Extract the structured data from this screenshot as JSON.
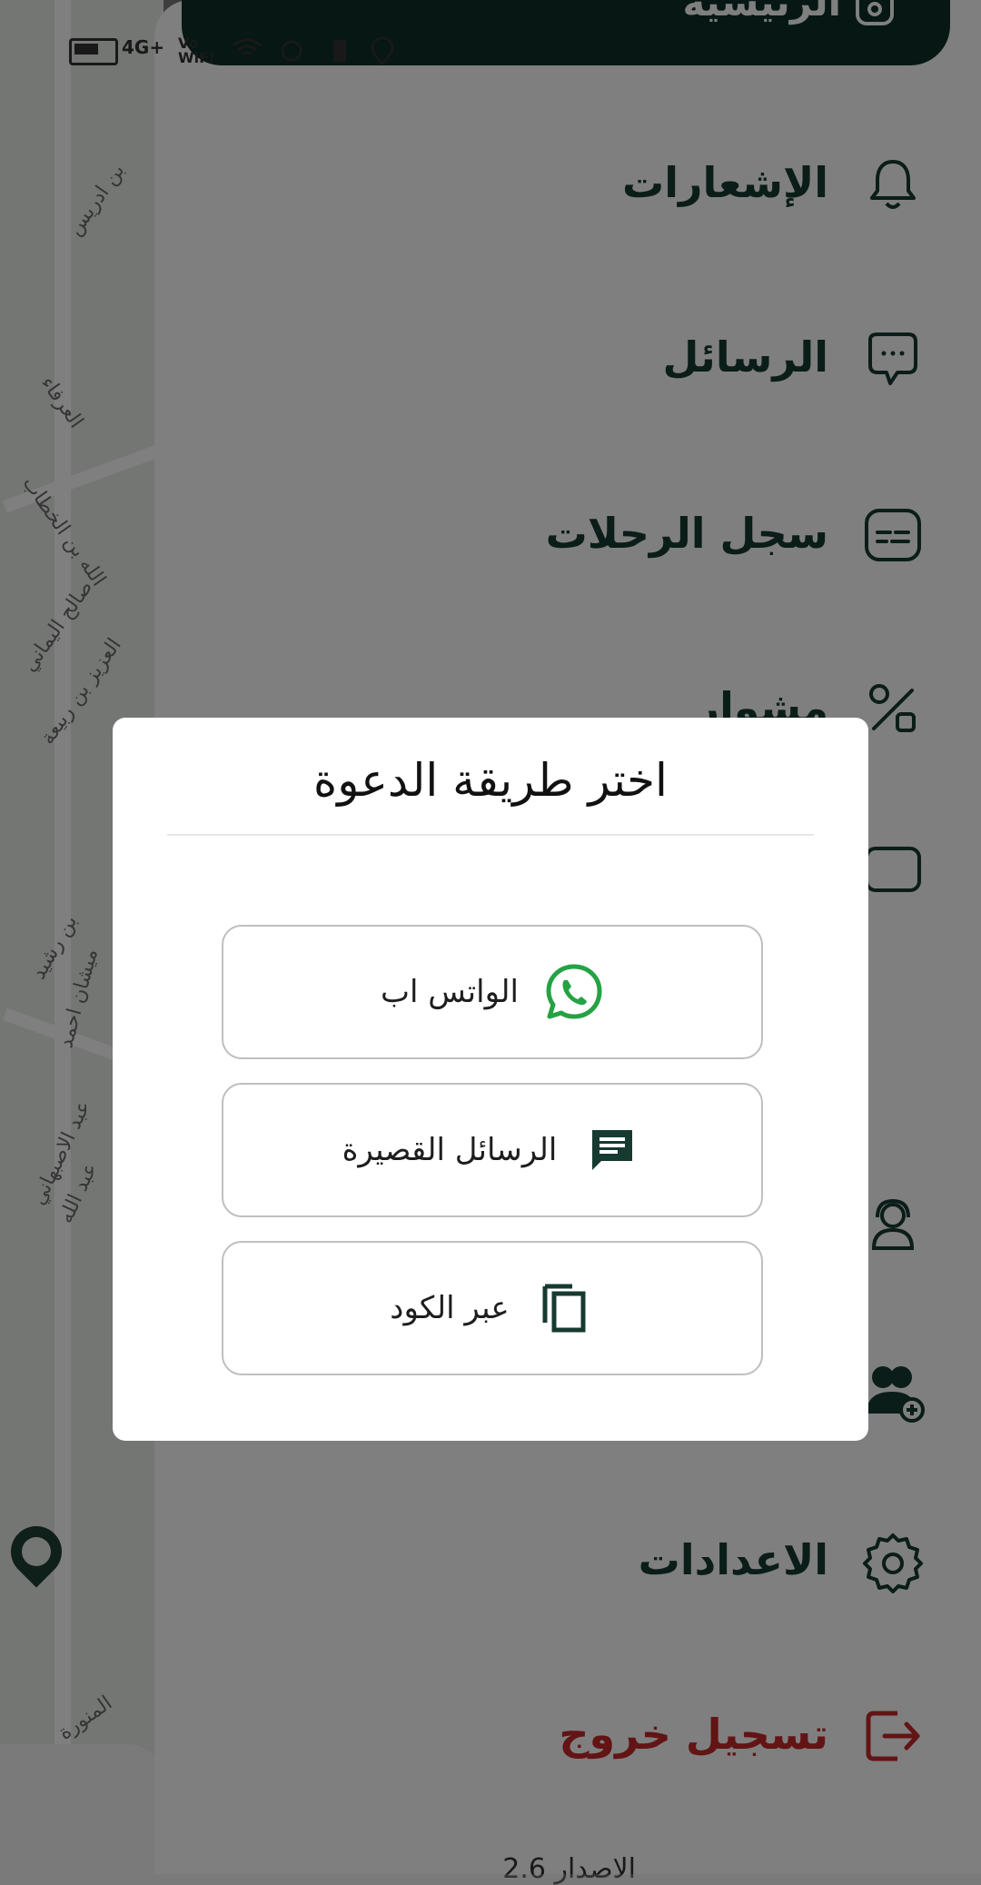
{
  "status_bar": {
    "left_icons": [
      "battery-icon",
      "signal-4g-icon",
      "vowifi-icon",
      "wifi-icon",
      "alarm-icon",
      "battery-saver-icon",
      "location-icon"
    ],
    "network_label": "4G+",
    "vowifi_label": "Vo WiFi"
  },
  "drawer": {
    "header_label": "الرئيسية",
    "items": [
      {
        "label": "الإشعارات",
        "icon": "bell-icon"
      },
      {
        "label": "الرسائل",
        "icon": "chat-icon"
      },
      {
        "label": "سجل الرحلات",
        "icon": "trips-log-icon"
      },
      {
        "label": "مشوار",
        "icon": "percent-icon"
      },
      {
        "label": "",
        "icon": "wallet-icon"
      },
      {
        "label": "",
        "icon": "support-agent-icon"
      },
      {
        "label": "",
        "icon": "add-user-icon"
      },
      {
        "label": "الاعدادات",
        "icon": "gear-icon"
      },
      {
        "label": "تسجيل خروج",
        "icon": "logout-icon"
      }
    ],
    "version": "الاصدار 2.6"
  },
  "map": {
    "streets": [
      "بن ادريس",
      "العرفاء",
      "الله بن الخطاب",
      "صالح اليماني",
      "العزيز بن ربيعة",
      "بن رشيد",
      "ميشان احمد",
      "عبد الاصبهاني",
      "عبد الله",
      "المنورة"
    ]
  },
  "dialog": {
    "title": "اختر طريقة الدعوة",
    "options": [
      {
        "label": "الواتس اب",
        "icon": "whatsapp-icon",
        "icon_color": "#25a244"
      },
      {
        "label": "الرسائل القصيرة",
        "icon": "sms-icon",
        "icon_color": "#163a30"
      },
      {
        "label": "عبر الكود",
        "icon": "copy-icon",
        "icon_color": "#163a30"
      }
    ]
  },
  "colors": {
    "primary_dark": "#0e2f27",
    "menu_text": "#163a30",
    "logout": "#c62828",
    "whatsapp": "#25a244"
  }
}
